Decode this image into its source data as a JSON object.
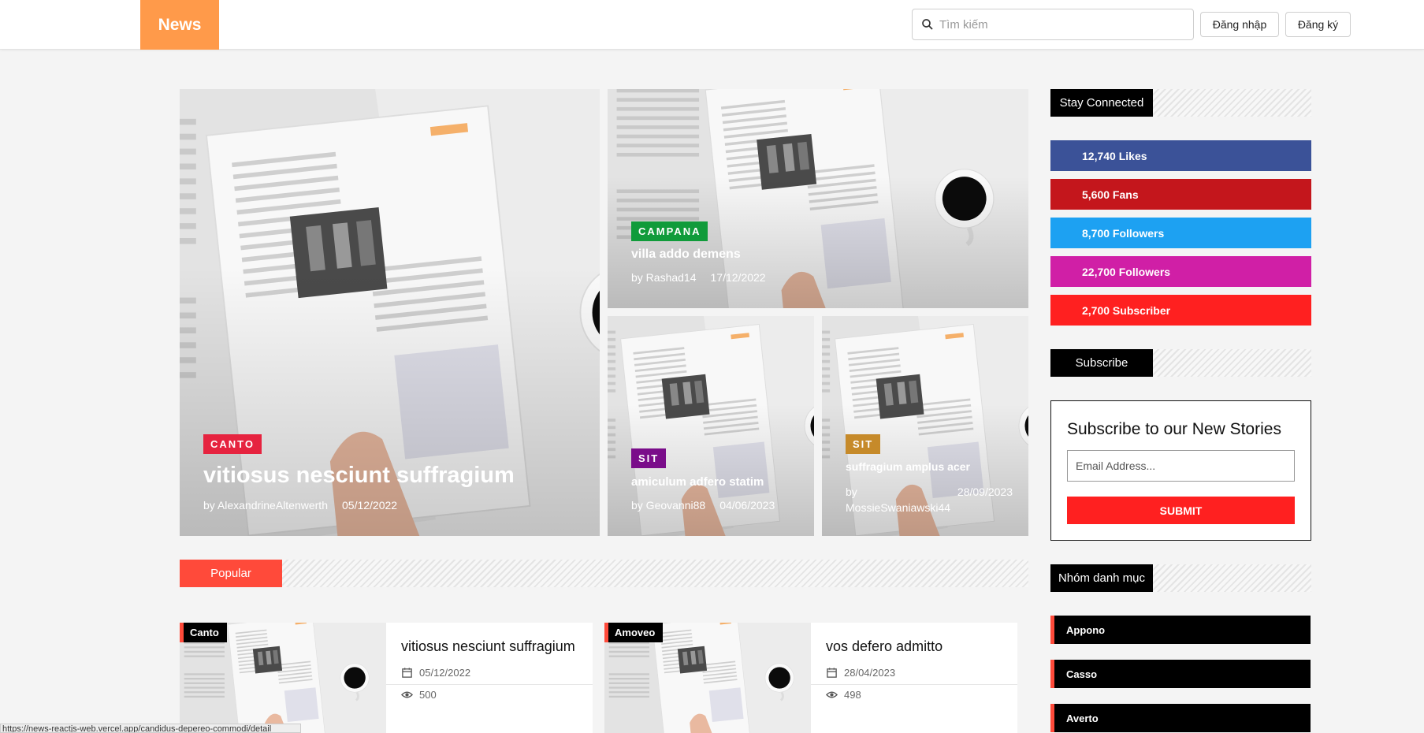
{
  "header": {
    "logo": "News",
    "search_placeholder": "Tìm kiếm",
    "login": "Đăng nhập",
    "register": "Đăng ký"
  },
  "hero": {
    "main": {
      "tag": "CANTO",
      "tag_color": "#e6233f",
      "title": "vitiosus nesciunt suffragium",
      "author": "by AlexandrineAltenwerth",
      "date": "05/12/2022"
    },
    "top_right": {
      "tag": "CAMPANA",
      "tag_color": "#109b3a",
      "title": "villa addo demens",
      "author": "by Rashad14",
      "date": "17/12/2022"
    },
    "bottom_left": {
      "tag": "SIT",
      "tag_color": "#7a0d8a",
      "title": "amiculum adfero statim",
      "author": "by Geovanni88",
      "date": "04/06/2023"
    },
    "bottom_right": {
      "tag": "SIT",
      "tag_color": "#c68a2a",
      "title": "suffragium amplus acer",
      "author": "by MossieSwaniawski44",
      "date": "28/09/2023"
    }
  },
  "popular": {
    "heading": "Popular",
    "cards": [
      {
        "tag": "Canto",
        "title": "vitiosus nesciunt suffragium",
        "date": "05/12/2022",
        "views": "500"
      },
      {
        "tag": "Amoveo",
        "title": "vos defero admitto",
        "date": "28/04/2023",
        "views": "498"
      }
    ]
  },
  "sidebar": {
    "stay_connected": "Stay Connected",
    "social": [
      {
        "label": "12,740 Likes",
        "color": "#3b5298"
      },
      {
        "label": "5,600 Fans",
        "color": "#c4161c"
      },
      {
        "label": "8,700 Followers",
        "color": "#1da1f2"
      },
      {
        "label": "22,700 Followers",
        "color": "#d01fa6"
      },
      {
        "label": "2,700 Subscriber",
        "color": "#ff2020"
      }
    ],
    "subscribe_heading": "Subscribe",
    "subscribe_box": {
      "title": "Subscribe to our New Stories",
      "email_placeholder": "Email Address...",
      "submit": "SUBMIT"
    },
    "categories_heading": "Nhóm danh mục",
    "categories": [
      "Appono",
      "Casso",
      "Averto"
    ]
  },
  "status_url": "https://news-reactjs-web.vercel.app/candidus-depereo-commodi/detail"
}
